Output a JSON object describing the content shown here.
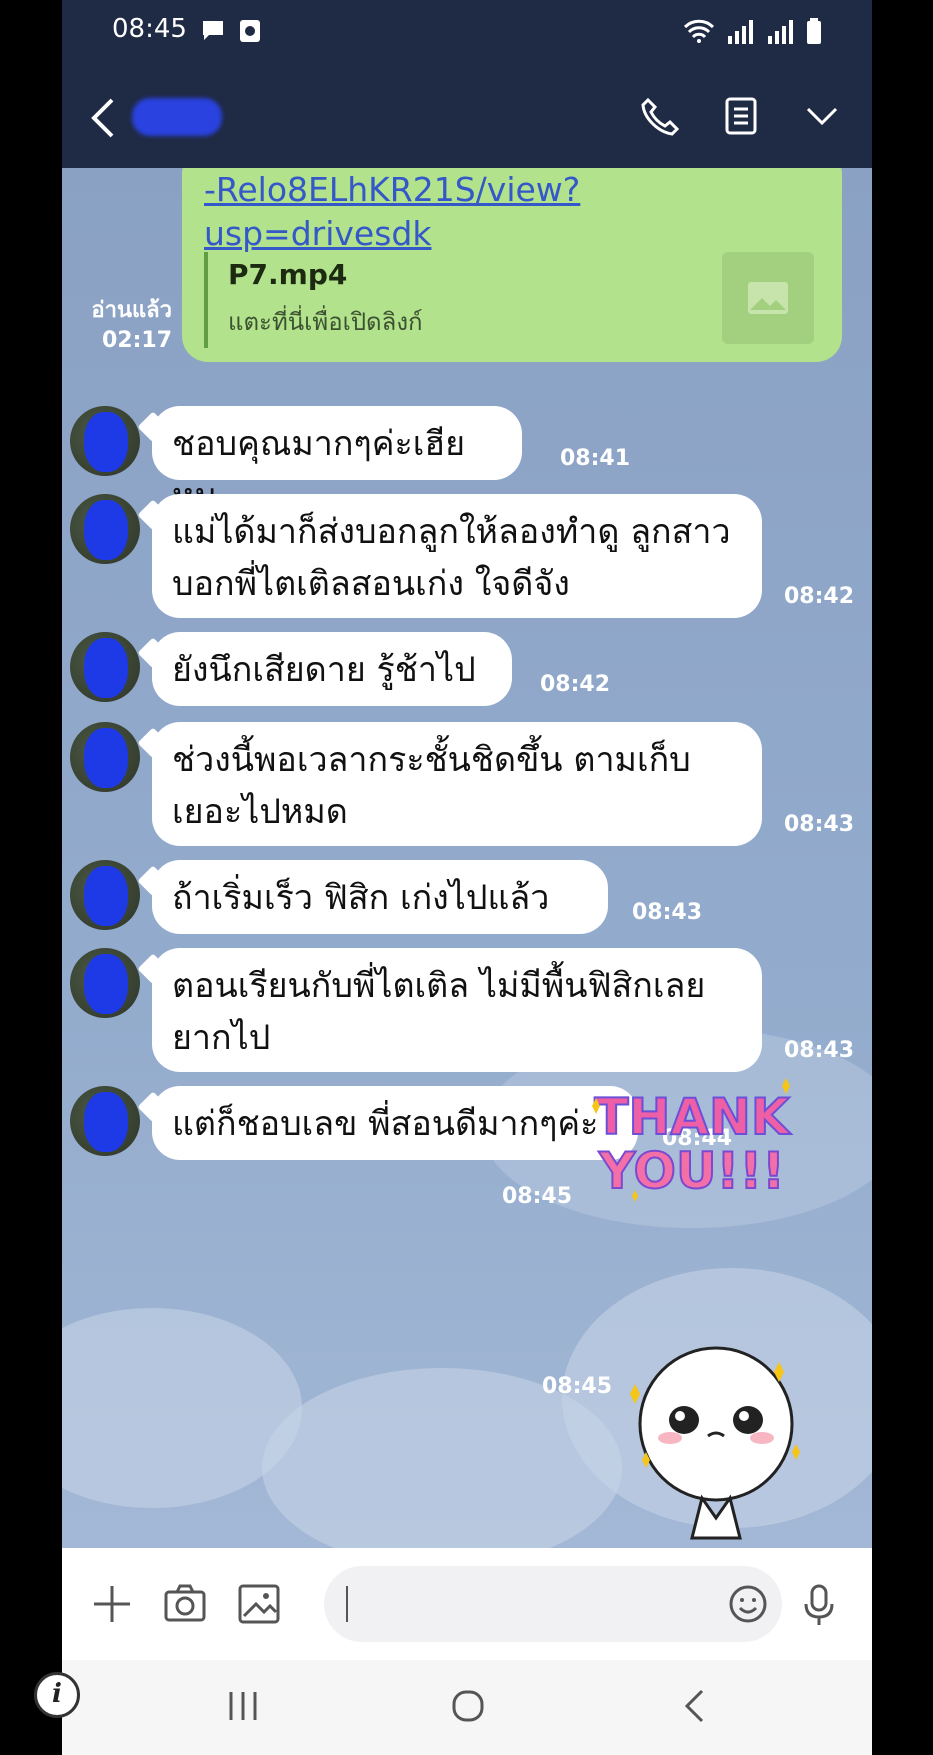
{
  "status_bar": {
    "time": "08:45"
  },
  "chat": {
    "link_message": {
      "url_text": "-Relo8ELhKR21S/view?usp=drivesdk",
      "file_name": "P7.mp4",
      "hint": "แตะที่นี่เพื่อเปิดลิงก์",
      "read_status": "อ่านแล้ว",
      "time": "02:17"
    },
    "messages": [
      {
        "text": "ชอบคุณมากๆค่ะเฮียหมู",
        "time": "08:41"
      },
      {
        "text": "แม่ได้มาก็ส่งบอกลูกให้ลองทำดู ลูกสาวบอกพี่ไตเติลสอนเก่ง  ใจดีจัง",
        "time": "08:42"
      },
      {
        "text": "ยังนึกเสียดาย  รู้ช้าไป",
        "time": "08:42"
      },
      {
        "text": "ช่วงนี้พอเวลากระชั้นชิดขึ้น  ตามเก็บเยอะไปหมด",
        "time": "08:43"
      },
      {
        "text": "ถ้าเริ่มเร็ว  ฟิสิก เก่งไปแล้ว",
        "time": "08:43"
      },
      {
        "text": "ตอนเรียนกับพี่ไตเติล  ไม่มีพื้นฟิสิกเลยยากไป",
        "time": "08:43"
      },
      {
        "text": "แต่ก็ชอบเลข  พี่สอนดีมากๆค่ะ",
        "time": "08:44"
      }
    ],
    "stickers": [
      {
        "text_line1": "THANK",
        "text_line2": "YOU!!!",
        "time": "08:45"
      },
      {
        "name": "crying-face-sticker",
        "time": "08:45"
      }
    ]
  },
  "colors": {
    "header_bg": "#1f2a44",
    "my_bubble": "#b2e28b",
    "link_color": "#3457c9",
    "chat_bg": "#8fa7c8"
  }
}
